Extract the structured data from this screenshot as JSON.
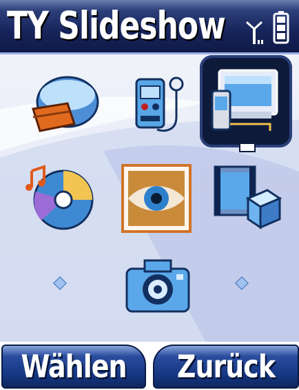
{
  "header": {
    "title": "TY Slideshow",
    "signal_icon": "antenna-signal-icon",
    "battery_icon": "battery-icon"
  },
  "menu": {
    "items": [
      {
        "icon": "media-storage-icon"
      },
      {
        "icon": "voice-recorder-icon"
      },
      {
        "icon": "tv-slideshow-icon",
        "selected": true
      },
      {
        "icon": "music-cd-icon"
      },
      {
        "icon": "image-eye-icon"
      },
      {
        "icon": "video-cube-icon"
      },
      {
        "icon": "camera-icon"
      }
    ]
  },
  "softkeys": {
    "left_label": "Wählen",
    "right_label": "Zurück"
  },
  "colors": {
    "header_dark": "#17245b",
    "accent_blue": "#2b4d9e",
    "selection_frame": "#0d1a3a"
  }
}
